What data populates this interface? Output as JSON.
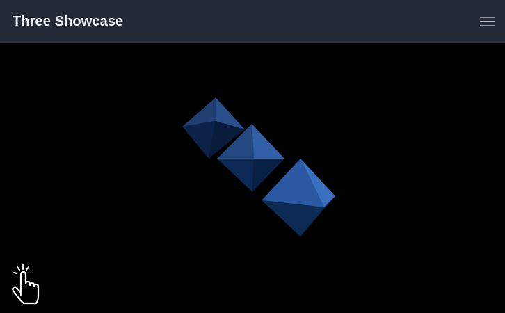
{
  "navbar": {
    "brand": "Three Showcase",
    "menu_icon": "hamburger-menu-icon"
  },
  "scene": {
    "objects": [
      "octahedron-1",
      "octahedron-2",
      "octahedron-3"
    ],
    "colors": {
      "face_light": "#2f5fae",
      "face_mid": "#1f4587",
      "face_dark": "#0d2a55",
      "face_darkest": "#061a38",
      "background": "#000000"
    }
  },
  "hint": {
    "icon": "tap-hand-icon"
  },
  "colors": {
    "navbar_bg": "#222a36",
    "brand_text": "#f2f4f7"
  }
}
